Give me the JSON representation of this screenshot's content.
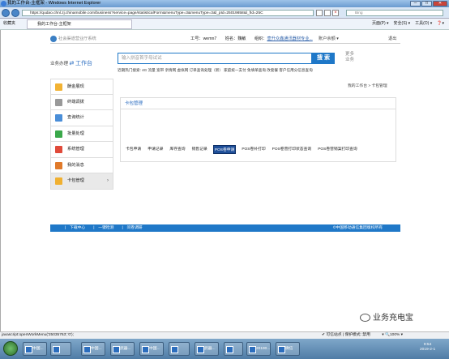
{
  "window": {
    "title": "我的工作台-主框架 - Windows Internet Explorer",
    "controls": [
      "─",
      "□",
      "✕"
    ]
  },
  "address": {
    "url": "https://qudao.chnl.zj.chinamobile.com/business?service=page/statisticalForm&menuType=3&menuType=3&l_pId=25019858&l_fId=25C",
    "search_placeholder": "Bing"
  },
  "favbar": {
    "favorites": "收藏夹",
    "tab": "我的工作台-主框架",
    "tools": [
      "页面(P) ▾",
      "安全(S) ▾",
      "工具(O) ▾",
      "❓▾"
    ]
  },
  "header": {
    "logo": "社会渠道营业厅系统",
    "user": "工号：wemn7　　姓名：魏敏　　组织：",
    "org": "壶升众鑫通讯器材专业...",
    "account": "账户余额 ▾",
    "logout": "退出"
  },
  "biz": {
    "label": "业务办理",
    "workbench": "工作台"
  },
  "search": {
    "placeholder": "输入拼音首字母试试",
    "button": "搜 索",
    "more": "更多业务"
  },
  "hot": "近期热门搜索: 4G  流量  宽带  亲情网  虚拟网  订单查询处理（新）  家庭统一支付  免填单查询  改套餐  客户信用分信息查询",
  "sidebar": [
    {
      "label": "酬金展现",
      "color": "#f2b233"
    },
    {
      "label": "终端调拨",
      "color": "#999"
    },
    {
      "label": "查询统计",
      "color": "#4a8ed8"
    },
    {
      "label": "批量处理",
      "color": "#3aa84a"
    },
    {
      "label": "系统管理",
      "color": "#e04a3a"
    },
    {
      "label": "我的消息",
      "color": "#e07a2a"
    },
    {
      "label": "卡包管理",
      "color": "#f0b030",
      "chevron": "›"
    }
  ],
  "breadcrumb": "我的工作台 > 卡包管理",
  "panel": {
    "title": "卡包管理",
    "tabs": [
      "卡包申请",
      "申请记录",
      "库存查询",
      "销售记录",
      "POS卷申请",
      "POS卷补打印",
      "POS卷营打印状态查询",
      "POS卷营销案打印查询"
    ],
    "selected": 4
  },
  "footer": {
    "links": [
      "|　下载中心",
      "|　一键检测",
      "|　问卷调研"
    ],
    "copyright": "©中国移动通信集团版权所有"
  },
  "status": {
    "left": "javascript:openWorkMenu('25035763','0');",
    "right": "✔ 可信站点 | 保护模式: 禁用　　　▾ 🔍100% ▾"
  },
  "taskbar": {
    "items": [
      "中国...",
      "",
      "中国...",
      "武器...",
      "中国...",
      "",
      "武器...",
      "",
      "20190...",
      "微信"
    ],
    "time": "9:54",
    "date": "2019-2-1"
  },
  "watermark": "业务充电宝"
}
